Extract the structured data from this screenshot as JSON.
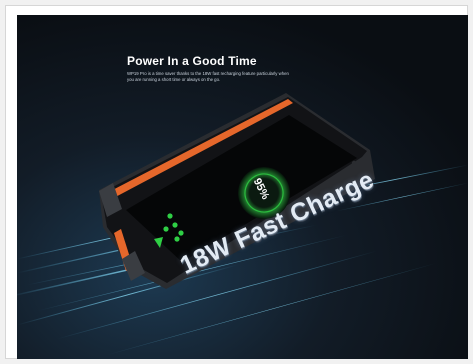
{
  "banner": {
    "title": "Power In a Good Time",
    "description": "WP19 Pro is a time saver thanks to the 18W fast recharging feature particularly when you are running a short time or always on the go.",
    "charge_percent": "95%",
    "caption": "18W Fast Charge",
    "background_color": "#0d1218",
    "accent_color": "#e5672b",
    "charge_color": "#2fcf45"
  },
  "icons": [
    "phone-image",
    "speed-streak-lines",
    "brand-logo-icon",
    "charging-ring-icon"
  ]
}
